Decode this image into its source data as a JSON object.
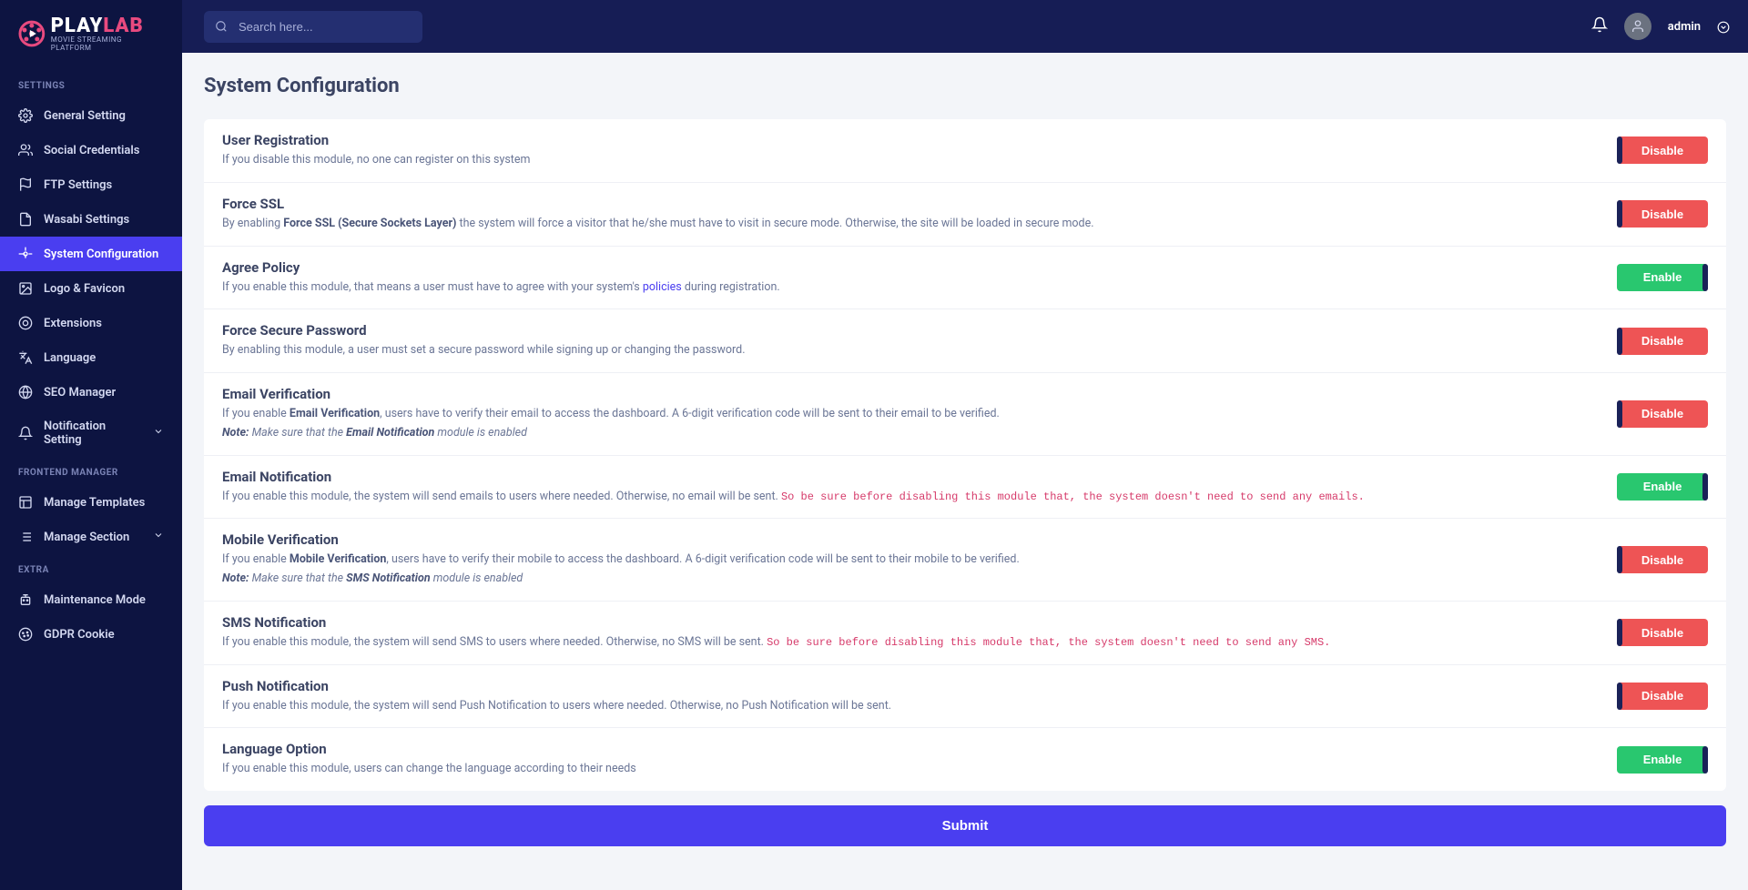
{
  "brand": {
    "name_a": "PLAY",
    "name_b": "LAB",
    "tagline": "MOVIE STREAMING PLATFORM"
  },
  "search": {
    "placeholder": "Search here..."
  },
  "user": {
    "name": "admin"
  },
  "nav": {
    "section1_title": "SETTINGS",
    "section2_title": "FRONTEND MANAGER",
    "section3_title": "EXTRA",
    "items1": [
      {
        "label": "General Setting"
      },
      {
        "label": "Social Credentials"
      },
      {
        "label": "FTP Settings"
      },
      {
        "label": "Wasabi Settings"
      },
      {
        "label": "System Configuration"
      },
      {
        "label": "Logo & Favicon"
      },
      {
        "label": "Extensions"
      },
      {
        "label": "Language"
      },
      {
        "label": "SEO Manager"
      },
      {
        "label": "Notification Setting"
      }
    ],
    "items2": [
      {
        "label": "Manage Templates"
      },
      {
        "label": "Manage Section"
      }
    ],
    "items3": [
      {
        "label": "Maintenance Mode"
      },
      {
        "label": "GDPR Cookie"
      }
    ]
  },
  "page": {
    "title": "System Configuration",
    "submit": "Submit",
    "disable_label": "Disable",
    "enable_label": "Enable"
  },
  "rows": [
    {
      "title": "User Registration",
      "desc": "If you disable this module, no one can register on this system",
      "state": "disable"
    },
    {
      "title": "Force SSL",
      "desc": "By enabling <b>Force SSL (Secure Sockets Layer)</b> the system will force a visitor that he/she must have to visit in secure mode. Otherwise, the site will be loaded in secure mode.",
      "state": "disable"
    },
    {
      "title": "Agree Policy",
      "desc": "If you enable this module, that means a user must have to agree with your system's <a href='#'>policies</a> during registration.",
      "state": "enable"
    },
    {
      "title": "Force Secure Password",
      "desc": "By enabling this module, a user must set a secure password while signing up or changing the password.",
      "state": "disable"
    },
    {
      "title": "Email Verification",
      "desc": "If you enable <b>Email Verification</b>, users have to verify their email to access the dashboard. A 6-digit verification code will be sent to their email to be verified.<span class='note-line'><i><b>Note:</b> Make sure that the <b>Email Notification</b> module is enabled</i></span>",
      "state": "disable"
    },
    {
      "title": "Email Notification",
      "desc": "If you enable this module, the system will send emails to users where needed. Otherwise, no email will be sent. <span class='warn'>So be sure before disabling this module that, the system doesn't need to send any emails.</span>",
      "state": "enable"
    },
    {
      "title": "Mobile Verification",
      "desc": "If you enable <b>Mobile Verification</b>, users have to verify their mobile to access the dashboard. A 6-digit verification code will be sent to their mobile to be verified.<span class='note-line'><i><b>Note:</b> Make sure that the <b>SMS Notification</b> module is enabled</i></span>",
      "state": "disable"
    },
    {
      "title": "SMS Notification",
      "desc": "If you enable this module, the system will send SMS to users where needed. Otherwise, no SMS will be sent. <span class='warn'>So be sure before disabling this module that, the system doesn't need to send any SMS.</span>",
      "state": "disable"
    },
    {
      "title": "Push Notification",
      "desc": "If you enable this module, the system will send Push Notification to users where needed. Otherwise, no Push Notification will be sent.",
      "state": "disable"
    },
    {
      "title": "Language Option",
      "desc": "If you enable this module, users can change the language according to their needs",
      "state": "enable"
    }
  ]
}
